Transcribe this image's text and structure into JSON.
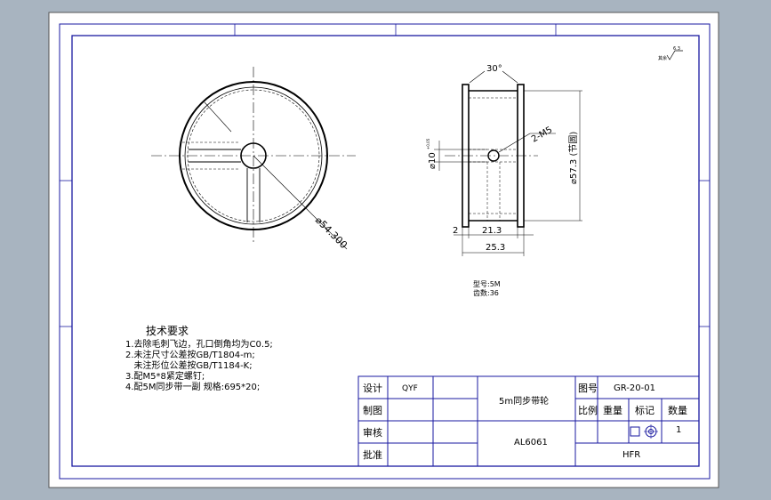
{
  "colors": {
    "background": "#a8b4c0",
    "sheet": "#ffffff",
    "frame": "#1a1aa0",
    "line": "#000000"
  },
  "roughness": {
    "value": "6.3",
    "prefix": "其余"
  },
  "views": {
    "front": {
      "diameter_label": "⌀54.300"
    },
    "side": {
      "angle_label": "30°",
      "hole_label": "2-M5",
      "bore_label": "⌀10",
      "bore_tol": "+0.05",
      "pitch_label": "⌀57.3 (节圆)",
      "flange_label": "2",
      "inner_width_label": "21.3",
      "total_width_label": "25.3"
    }
  },
  "specs": [
    "型号:5M",
    "齿数:36"
  ],
  "tech_req": {
    "title": "技术要求",
    "items": [
      "1.去除毛刺飞边，孔口倒角均为C0.5;",
      "2.未注尺寸公差按GB/T1804-m;",
      "   未注形位公差按GB/T1184-K;",
      "3.配M5*8紧定螺钉;",
      "4.配5M同步带一副 规格:695*20;"
    ]
  },
  "title_block": {
    "rows": [
      "设计",
      "制图",
      "审核",
      "批准"
    ],
    "designer": "QYF",
    "part_name": "5m同步带轮",
    "material": "AL6061",
    "drawing_no_label": "图号",
    "drawing_no": "GR-20-01",
    "headers": [
      "比例",
      "重量",
      "标记",
      "数量"
    ],
    "quantity": "1",
    "company": "HFR"
  }
}
